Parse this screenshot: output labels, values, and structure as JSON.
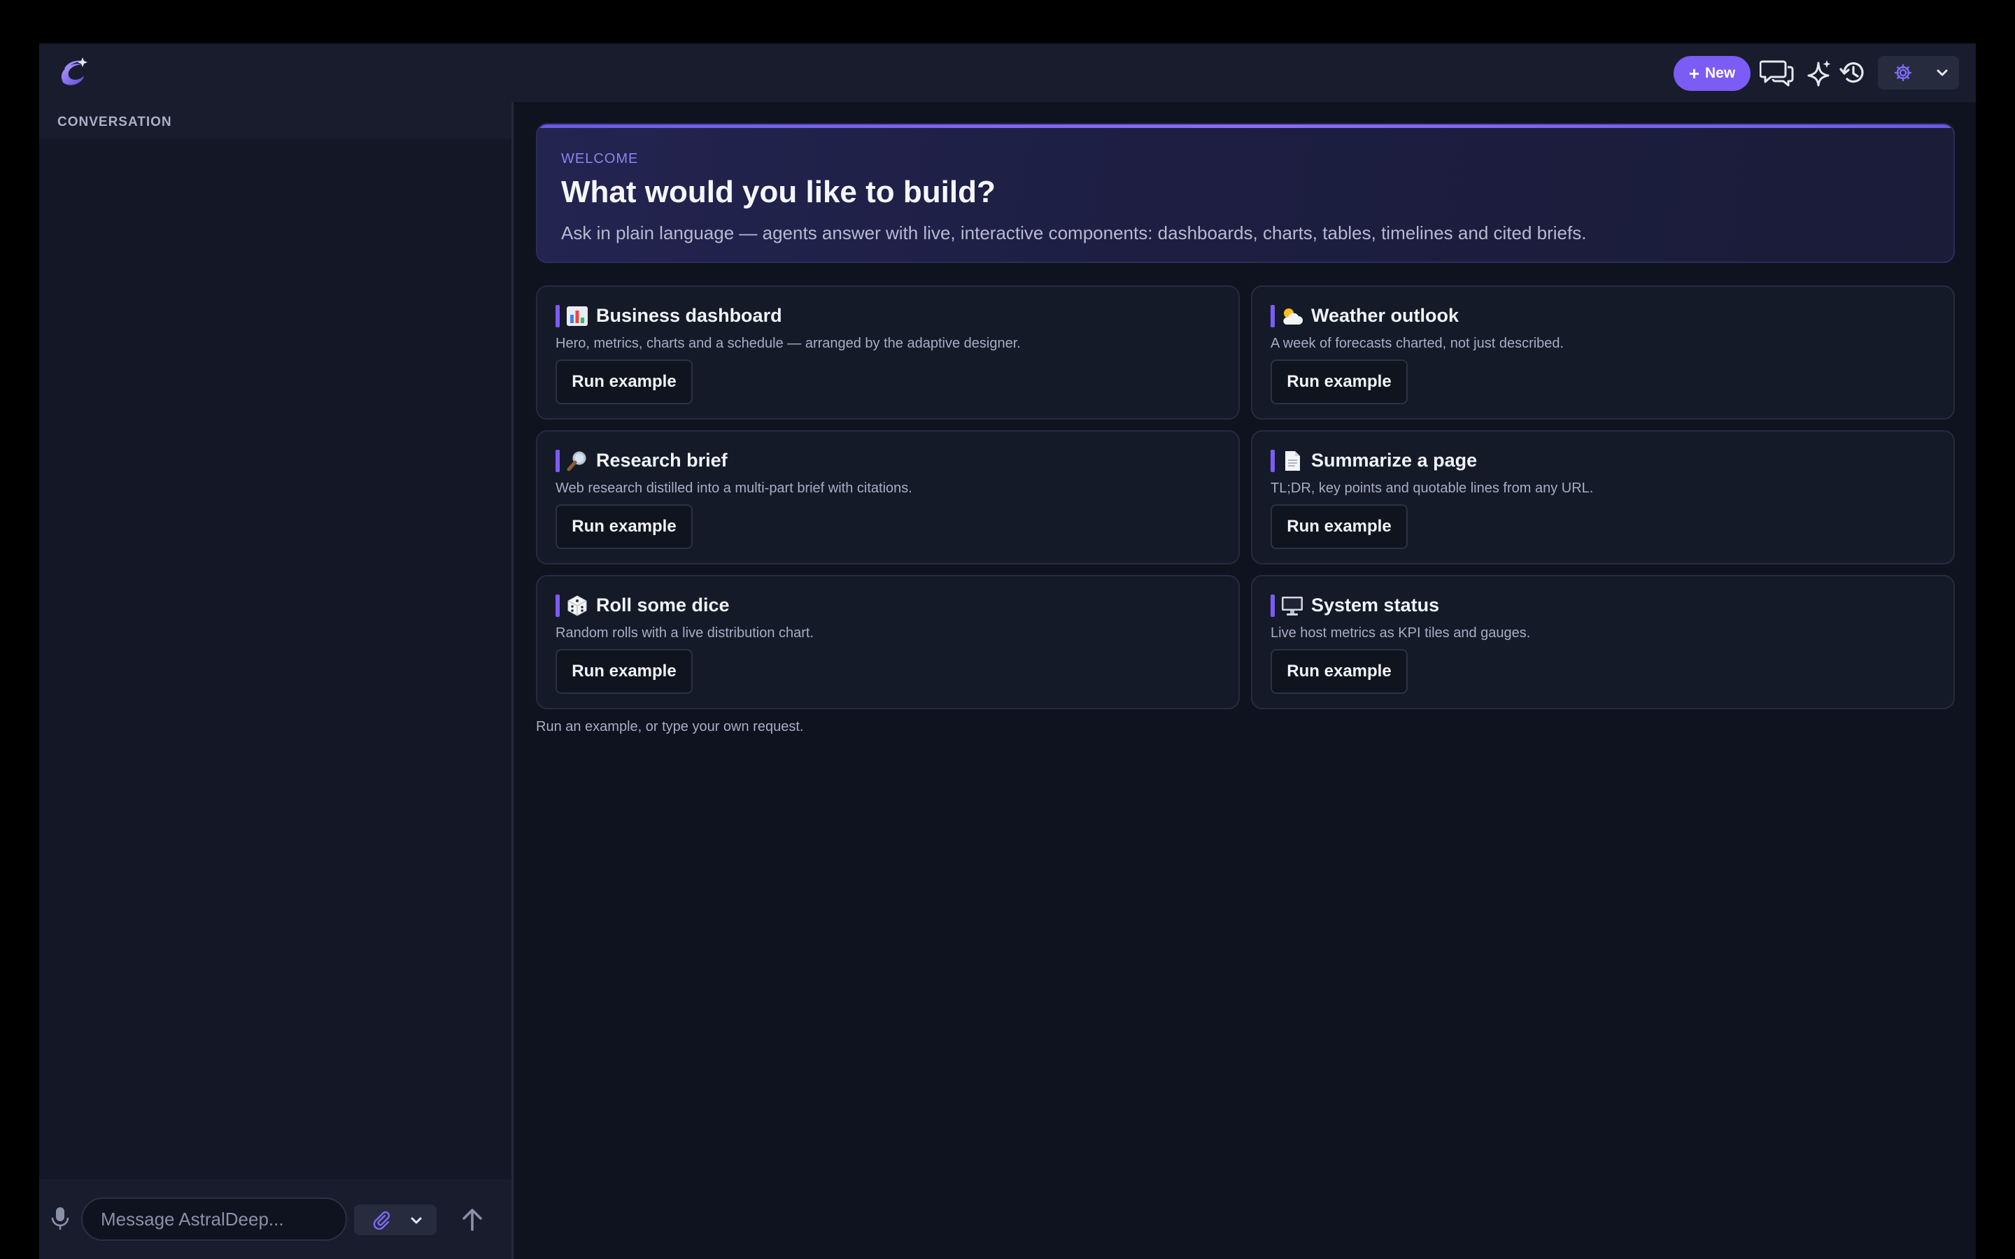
{
  "app": {
    "name": "AstralDeep",
    "accent_color": "#7b5cf5"
  },
  "topbar": {
    "logo_icon": "swirl-logo-icon",
    "new_button": {
      "icon": "plus-icon",
      "label": "New"
    },
    "icons": [
      "chat-bubbles-icon",
      "sparkle-icon",
      "history-icon",
      "gear-icon",
      "chevron-down-icon"
    ]
  },
  "sidebar": {
    "title": "CONVERSATION",
    "composer": {
      "placeholder": "Message AstralDeep...",
      "icons": [
        "mic-icon",
        "paperclip-icon",
        "chevron-down-icon",
        "send-arrow-icon"
      ]
    }
  },
  "welcome": {
    "eyebrow": "WELCOME",
    "title": "What would you like to build?",
    "subtitle": "Ask in plain language — agents answer with live, interactive components: dashboards, charts, tables, timelines and cited briefs."
  },
  "examples": [
    {
      "icon": "bar-chart-icon",
      "title": "Business dashboard",
      "description": "Hero, metrics, charts and a schedule — arranged by the adaptive designer.",
      "button": "Run example"
    },
    {
      "icon": "cloud-sun-icon",
      "title": "Weather outlook",
      "description": "A week of forecasts charted, not just described.",
      "button": "Run example"
    },
    {
      "icon": "magnifier-icon",
      "title": "Research brief",
      "description": "Web research distilled into a multi-part brief with citations.",
      "button": "Run example"
    },
    {
      "icon": "document-icon",
      "title": "Summarize a page",
      "description": "TL;DR, key points and quotable lines from any URL.",
      "button": "Run example"
    },
    {
      "icon": "dice-icon",
      "title": "Roll some dice",
      "description": "Random rolls with a live distribution chart.",
      "button": "Run example"
    },
    {
      "icon": "monitor-icon",
      "title": "System status",
      "description": "Live host metrics as KPI tiles and gauges.",
      "button": "Run example"
    }
  ],
  "footer_hint": "Run an example, or type your own request."
}
